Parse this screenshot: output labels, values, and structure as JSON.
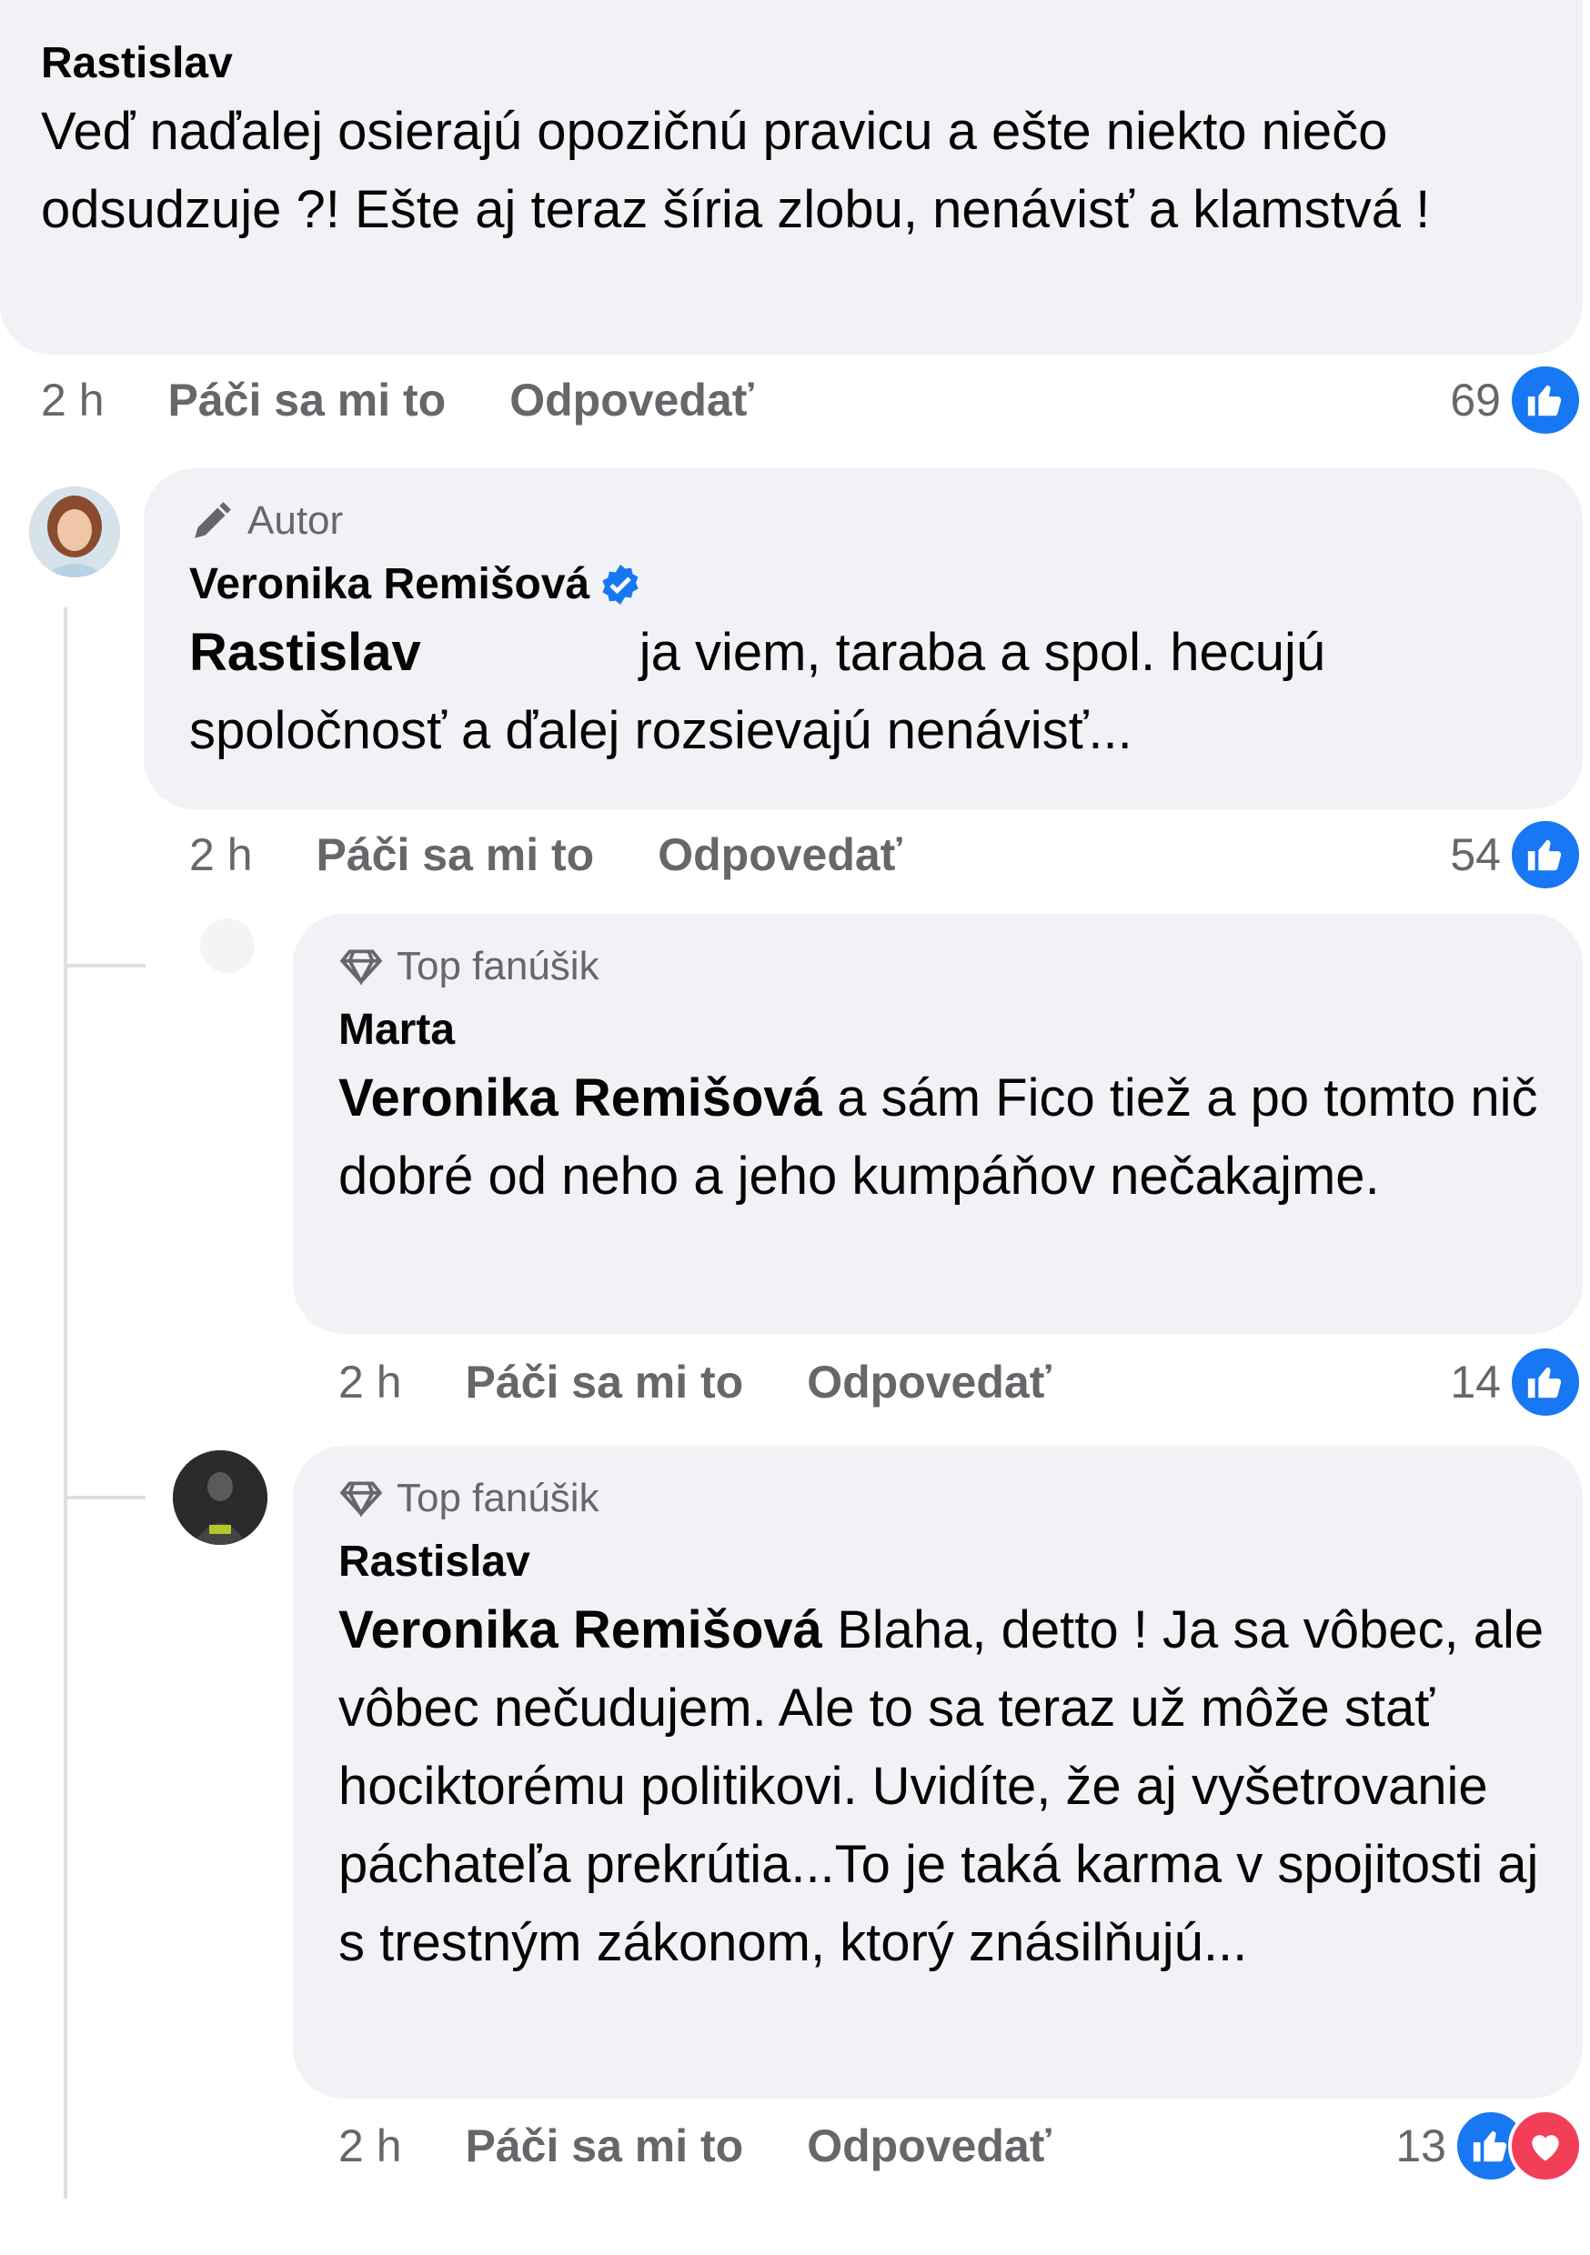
{
  "comments": [
    {
      "author": "Rastislav",
      "text": "Veď naďalej osierajú opozičnú pravicu a ešte niekto niečo odsudzuje ?! Ešte aj teraz šíria zlobu, nenávisť a klamstvá !",
      "time": "2 h",
      "like_label": "Páči sa mi to",
      "reply_label": "Odpovedať",
      "reaction_count": "69"
    },
    {
      "badge": "Autor",
      "author": "Veronika Remišová",
      "mention": "Rastislav",
      "text": "ja viem, taraba a spol. hecujú spoločnosť a ďalej rozsievajú nenávisť...",
      "time": "2 h",
      "like_label": "Páči sa mi to",
      "reply_label": "Odpovedať",
      "reaction_count": "54"
    },
    {
      "badge": "Top fanúšik",
      "author": "Marta",
      "mention": "Veronika Remišová",
      "text": "a sám Fico tiež a po tomto nič dobré od neho a jeho kumpáňov nečakajme.",
      "time": "2 h",
      "like_label": "Páči sa mi to",
      "reply_label": "Odpovedať",
      "reaction_count": "14"
    },
    {
      "badge": "Top fanúšik",
      "author": "Rastislav",
      "mention": "Veronika Remišová",
      "text": "Blaha, detto ! Ja sa vôbec, ale vôbec nečudujem. Ale to sa teraz už môže stať hociktorému politikovi. Uvidíte, že aj vyšetrovanie páchateľa prekrútia...To je taká karma v spojitosti aj s trestným zákonom, ktorý znásilňujú...",
      "time": "2 h",
      "like_label": "Páči sa mi to",
      "reply_label": "Odpovedať",
      "reaction_count": "13"
    }
  ],
  "icons": {
    "reaction_like": "thumbs-up-icon",
    "reaction_love": "heart-icon",
    "author_badge": "pencil-icon",
    "fan_badge": "diamond-icon",
    "verified": "verified-badge-icon"
  },
  "colors": {
    "bubble": "#f0f2f5",
    "meta_text": "#65676b",
    "like_blue": "#1877f2",
    "love_red": "#f33e58"
  }
}
